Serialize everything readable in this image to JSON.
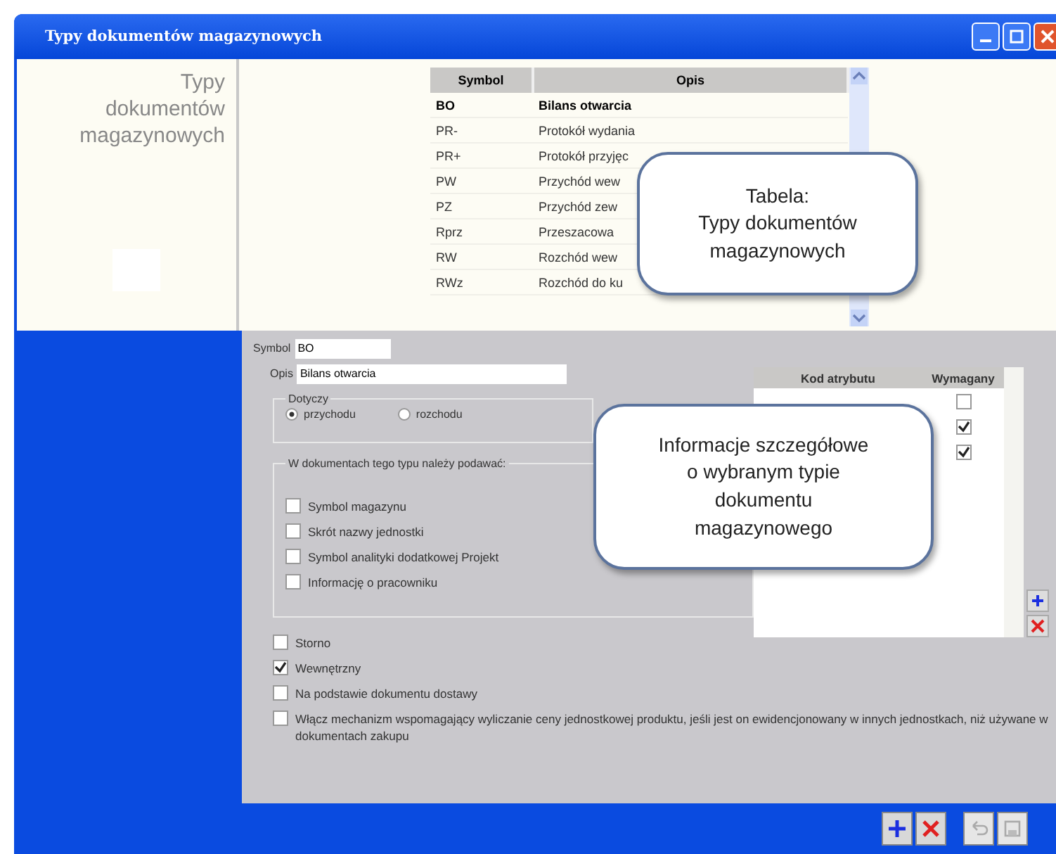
{
  "window": {
    "title": "Typy dokumentów magazynowych"
  },
  "side_title": "Typy dokumentów magazynowych",
  "doc_table": {
    "columns": [
      "Symbol",
      "Opis"
    ],
    "rows": [
      {
        "symbol": "BO",
        "opis": "Bilans otwarcia",
        "selected": true
      },
      {
        "symbol": "PR-",
        "opis": "Protokół wydania",
        "selected": false
      },
      {
        "symbol": "PR+",
        "opis": "Protokół przyjęc",
        "selected": false
      },
      {
        "symbol": "PW",
        "opis": "Przychód wew",
        "selected": false
      },
      {
        "symbol": "PZ",
        "opis": "Przychód zew",
        "selected": false
      },
      {
        "symbol": "Rprz",
        "opis": "Przeszacowa",
        "selected": false
      },
      {
        "symbol": "RW",
        "opis": "Rozchód wew",
        "selected": false
      },
      {
        "symbol": "RWz",
        "opis": "Rozchód do ku",
        "selected": false
      }
    ]
  },
  "callout_table": "Tabela:\nTypy dokumentów\nmagazynowych",
  "form": {
    "symbol_label": "Symbol",
    "symbol_value": "BO",
    "opis_label": "Opis",
    "opis_value": "Bilans otwarcia",
    "dotyczy": {
      "label": "Dotyczy",
      "options": [
        {
          "label": "przychodu",
          "selected": true
        },
        {
          "label": "rozchodu",
          "selected": false
        }
      ]
    },
    "require_group": {
      "label": "W dokumentach tego typu należy podawać:",
      "items": [
        {
          "label": "Symbol magazynu",
          "checked": false
        },
        {
          "label": "Skrót nazwy jednostki",
          "checked": false
        },
        {
          "label": "Symbol analityki dodatkowej Projekt",
          "checked": false
        },
        {
          "label": "Informację o pracowniku",
          "checked": false
        }
      ]
    },
    "options": [
      {
        "label": "Storno",
        "checked": false
      },
      {
        "label": "Wewnętrzny",
        "checked": true
      },
      {
        "label": "Na podstawie dokumentu dostawy",
        "checked": false
      },
      {
        "label": "Włącz mechanizm wspomagający wyliczanie ceny jednostkowej produktu, jeśli jest on ewidencjonowany w innych jednostkach, niż używane w dokumentach zakupu",
        "checked": false
      }
    ]
  },
  "attr_table": {
    "columns": [
      "Kod atrybutu",
      "Wymagany"
    ],
    "rows": [
      {
        "required": false
      },
      {
        "required": true
      },
      {
        "required": true
      }
    ]
  },
  "callout_detail": "Informacje szczegółowe\no wybranym typie\ndokumentu\nmagazynowego"
}
